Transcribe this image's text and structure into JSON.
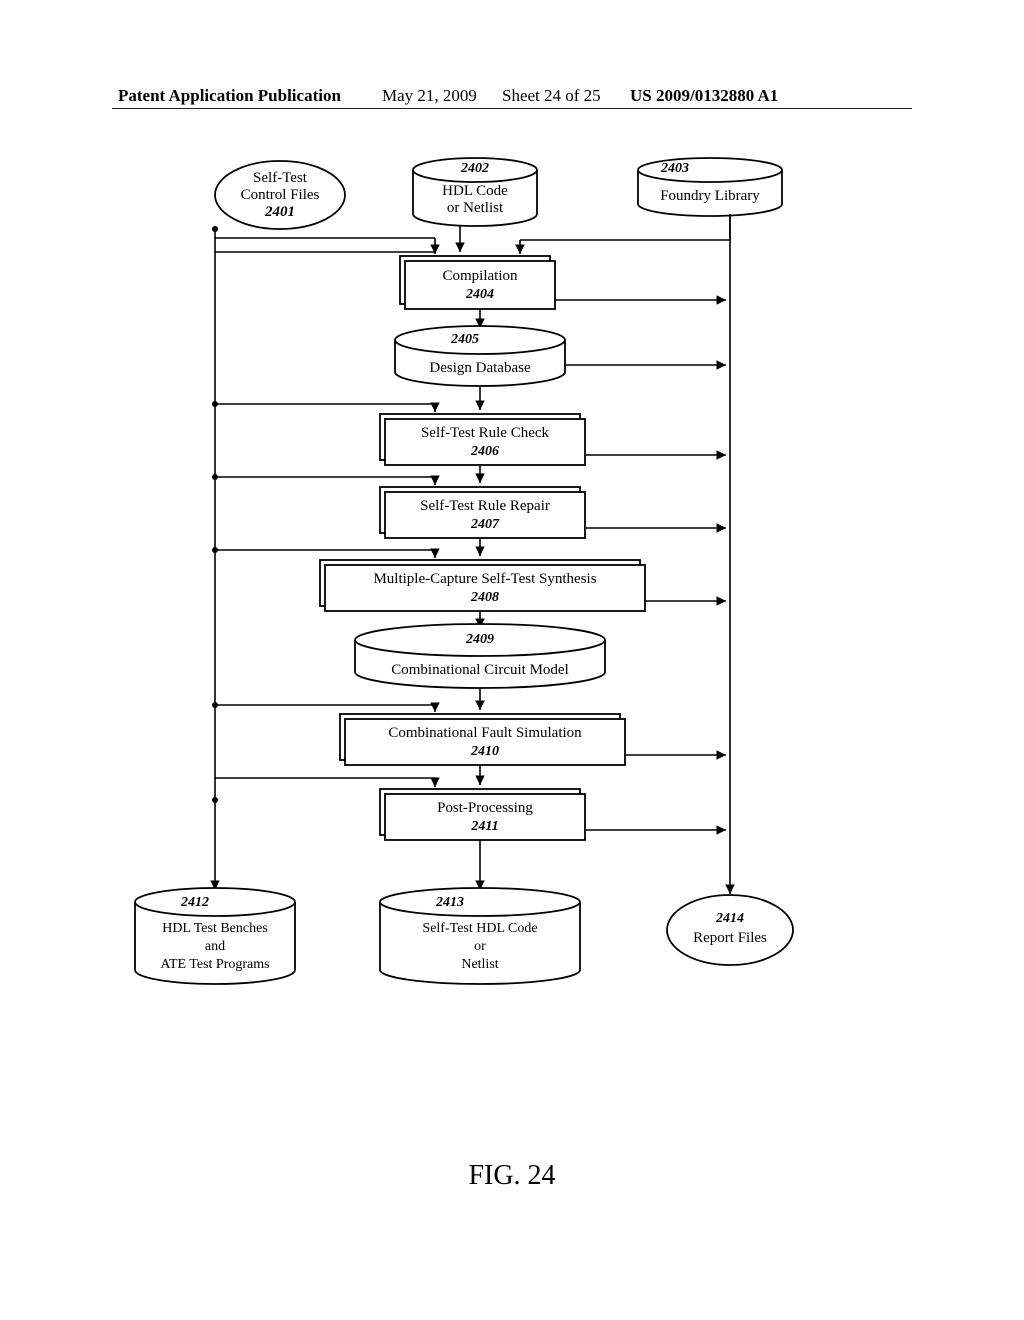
{
  "header": {
    "publication_label": "Patent Application Publication",
    "date": "May 21, 2009",
    "sheet": "Sheet 24 of 25",
    "pub_number": "US 2009/0132880 A1"
  },
  "figure_label": "FIG. 24",
  "nodes": {
    "2401": {
      "ref": "2401",
      "label": "Self-Test\nControl Files"
    },
    "2402": {
      "ref": "2402",
      "label": "HDL Code\nor Netlist"
    },
    "2403": {
      "ref": "2403",
      "label": "Foundry Library"
    },
    "2404": {
      "ref": "2404",
      "label": "Compilation"
    },
    "2405": {
      "ref": "2405",
      "label": "Design Database"
    },
    "2406": {
      "ref": "2406",
      "label": "Self-Test Rule Check"
    },
    "2407": {
      "ref": "2407",
      "label": "Self-Test Rule Repair"
    },
    "2408": {
      "ref": "2408",
      "label": "Multiple-Capture Self-Test Synthesis"
    },
    "2409": {
      "ref": "2409",
      "label": "Combinational Circuit Model"
    },
    "2410": {
      "ref": "2410",
      "label": "Combinational Fault Simulation"
    },
    "2411": {
      "ref": "2411",
      "label": "Post-Processing"
    },
    "2412": {
      "ref": "2412",
      "label": "HDL Test Benches\nand\nATE Test Programs"
    },
    "2413": {
      "ref": "2413",
      "label": "Self-Test HDL Code\nor\nNetlist"
    },
    "2414": {
      "ref": "2414",
      "label": "Report Files"
    }
  }
}
